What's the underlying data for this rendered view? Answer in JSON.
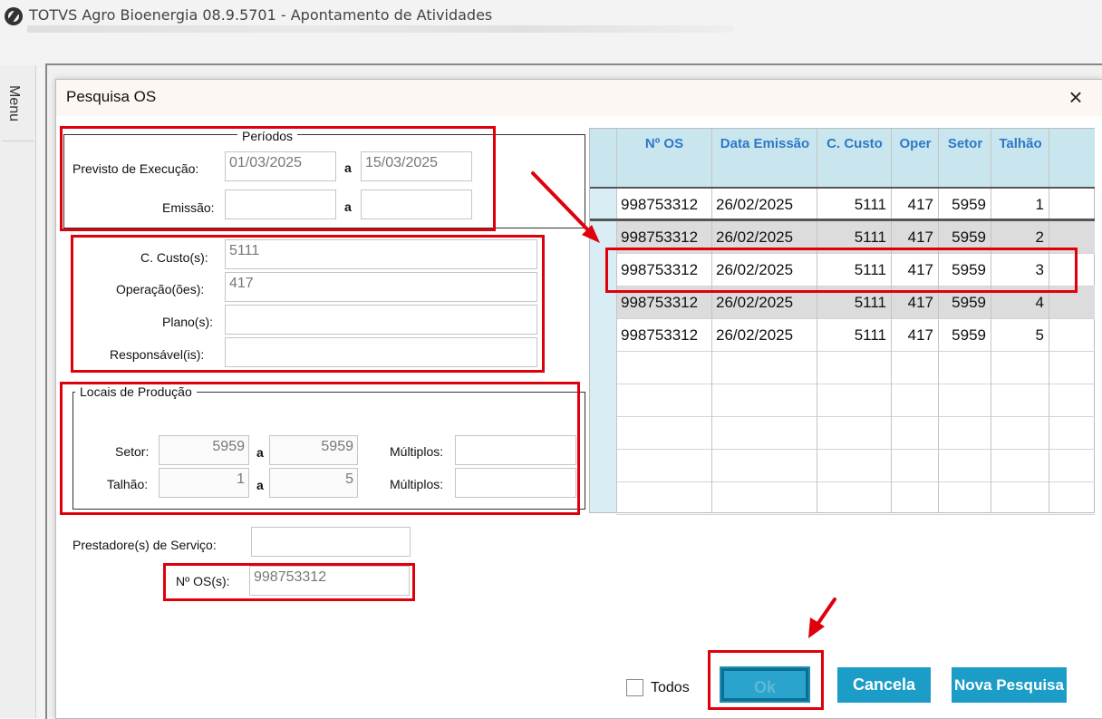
{
  "window": {
    "title": "TOTVS Agro Bioenergia 08.9.5701 - Apontamento de Atividades"
  },
  "side_menu": {
    "label": "Menu"
  },
  "dialog": {
    "title": "Pesquisa OS",
    "close_icon": "×"
  },
  "periodos": {
    "legend": "Períodos",
    "previsto_label": "Previsto de Execução:",
    "previsto_from": "01/03/2025",
    "previsto_sep": "a",
    "previsto_to": "15/03/2025",
    "emissao_label": "Emissão:",
    "emissao_from": "",
    "emissao_sep": "a",
    "emissao_to": ""
  },
  "filters": {
    "custo_label": "C. Custo(s):",
    "custo_value": "5111",
    "operacao_label": "Operação(ões):",
    "operacao_value": "417",
    "plano_label": "Plano(s):",
    "plano_value": "",
    "responsavel_label": "Responsável(is):",
    "responsavel_value": ""
  },
  "locais": {
    "legend": "Locais de Produção",
    "setor_label": "Setor:",
    "setor_from": "5959",
    "setor_sep": "a",
    "setor_to": "5959",
    "setor_multiplos_label": "Múltiplos:",
    "setor_multiplos_value": "",
    "talhao_label": "Talhão:",
    "talhao_from": "1",
    "talhao_sep": "a",
    "talhao_to": "5",
    "talhao_multiplos_label": "Múltiplos:",
    "talhao_multiplos_value": ""
  },
  "prestadores": {
    "label": "Prestadore(s) de Serviço:",
    "value": ""
  },
  "os_numbers": {
    "label": "Nº OS(s):",
    "value": "998753312"
  },
  "grid": {
    "headers": [
      "Nº OS",
      "Data Emissão",
      "C. Custo",
      "Oper",
      "Setor",
      "Talhão"
    ],
    "rows": [
      [
        "998753312",
        "26/02/2025",
        "5111",
        "417",
        "5959",
        "1"
      ],
      [
        "998753312",
        "26/02/2025",
        "5111",
        "417",
        "5959",
        "2"
      ],
      [
        "998753312",
        "26/02/2025",
        "5111",
        "417",
        "5959",
        "3"
      ],
      [
        "998753312",
        "26/02/2025",
        "5111",
        "417",
        "5959",
        "4"
      ],
      [
        "998753312",
        "26/02/2025",
        "5111",
        "417",
        "5959",
        "5"
      ]
    ],
    "selected_row_index": 2
  },
  "footer": {
    "todos_label": "Todos",
    "todos_checked": false,
    "ok_label": "Ok",
    "cancela_label": "Cancela",
    "nova_pesquisa_label": "Nova Pesquisa"
  },
  "colors": {
    "accent": "#1b9dc7",
    "annotation": "#e0000c",
    "grid_header": "#c9e6ef",
    "grid_header_text": "#2e78c6"
  }
}
